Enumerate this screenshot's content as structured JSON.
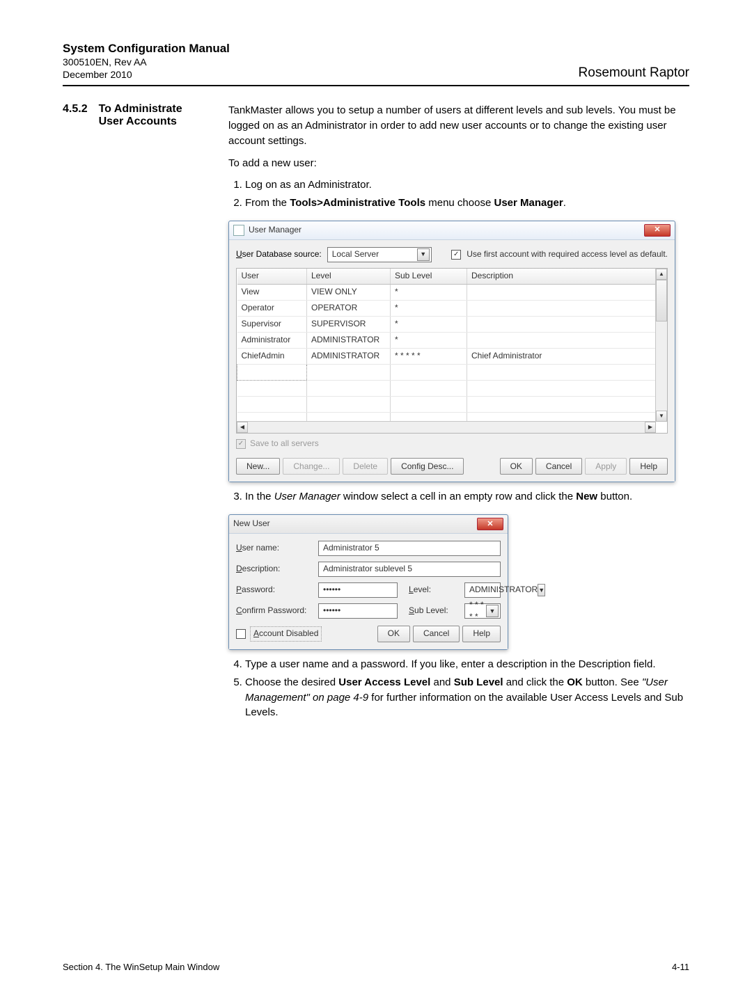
{
  "header": {
    "title": "System Configuration Manual",
    "doc_id": "300510EN, Rev AA",
    "date": "December 2010",
    "brand": "Rosemount Raptor"
  },
  "section": {
    "number": "4.5.2",
    "title_line1": "To Administrate",
    "title_line2": "User Accounts"
  },
  "body": {
    "intro": "TankMaster allows you to setup a number of users at different levels and sub levels. You must be logged on as an Administrator in order to add new user accounts or to change the existing user account settings.",
    "add_prompt": "To add a new user:",
    "step1": "Log on as an Administrator.",
    "step2_pre": "From the ",
    "step2_bold1": "Tools>Administrative Tools",
    "step2_mid": " menu choose ",
    "step2_bold2": "User Manager",
    "step2_end": ".",
    "step3_pre": "In the ",
    "step3_ital": "User Manager",
    "step3_mid": " window select a cell in an empty row and click the ",
    "step3_bold": "New",
    "step3_end": " button.",
    "step4": "Type a user name and a password. If you like, enter a description in the Description field.",
    "step5_pre": "Choose the desired ",
    "step5_b1": "User Access Level",
    "step5_mid1": " and ",
    "step5_b2": "Sub Level",
    "step5_mid2": " and click the ",
    "step5_b3": "OK",
    "step5_mid3": " button. See ",
    "step5_ital": "\"User Management\" on page 4-9",
    "step5_end": " for further information on the available User Access Levels and Sub Levels."
  },
  "user_manager": {
    "title": "User Manager",
    "db_source_label": "User Database source:",
    "db_source_value": "Local Server",
    "use_first_label": "Use first account with required access level as default.",
    "cols": {
      "user": "User",
      "level": "Level",
      "sublevel": "Sub Level",
      "desc": "Description"
    },
    "rows": [
      {
        "user": "View",
        "level": "VIEW ONLY",
        "sublevel": "*",
        "desc": ""
      },
      {
        "user": "Operator",
        "level": "OPERATOR",
        "sublevel": "*",
        "desc": ""
      },
      {
        "user": "Supervisor",
        "level": "SUPERVISOR",
        "sublevel": "*",
        "desc": ""
      },
      {
        "user": "Administrator",
        "level": "ADMINISTRATOR",
        "sublevel": "*",
        "desc": ""
      },
      {
        "user": "ChiefAdmin",
        "level": "ADMINISTRATOR",
        "sublevel": "* * * * *",
        "desc": "Chief Administrator"
      }
    ],
    "save_all_label": "Save to all servers",
    "buttons": {
      "new": "New...",
      "change": "Change...",
      "delete": "Delete",
      "config": "Config Desc...",
      "ok": "OK",
      "cancel": "Cancel",
      "apply": "Apply",
      "help": "Help"
    }
  },
  "new_user": {
    "title": "New User",
    "user_label": "User name:",
    "user_value": "Administrator 5",
    "desc_label": "Description:",
    "desc_value": "Administrator sublevel 5",
    "pass_label": "Password:",
    "pass_value": "••••••",
    "confirm_label": "Confirm Password:",
    "confirm_value": "••••••",
    "level_label": "Level:",
    "level_value": "ADMINISTRATOR",
    "sublevel_label": "Sub Level:",
    "sublevel_value": "* * * * *",
    "disabled_label": "Account Disabled",
    "buttons": {
      "ok": "OK",
      "cancel": "Cancel",
      "help": "Help"
    }
  },
  "footer": {
    "left": "Section 4. The WinSetup Main Window",
    "right": "4-11"
  }
}
